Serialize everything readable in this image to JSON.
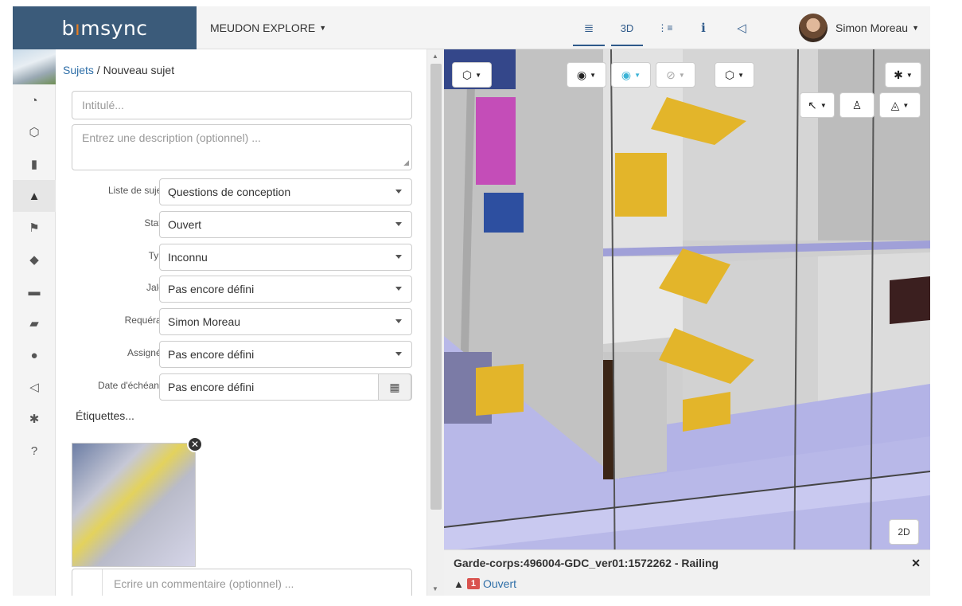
{
  "brand": {
    "pre": "b",
    "dot": "ı",
    "post": "msync"
  },
  "project": {
    "name": "MEUDON EXPLORE"
  },
  "nav": {
    "items": [
      {
        "name": "list",
        "glyph": "≣"
      },
      {
        "name": "3d",
        "glyph": "3D"
      },
      {
        "name": "tree",
        "glyph": "⋮≡"
      },
      {
        "name": "info",
        "glyph": "i"
      },
      {
        "name": "announce",
        "glyph": "◁"
      }
    ]
  },
  "user": {
    "name": "Simon Moreau"
  },
  "breadcrumb": {
    "link": "Sujets",
    "sep": " / ",
    "current": "Nouveau sujet"
  },
  "form": {
    "title_placeholder": "Intitulé...",
    "description_placeholder": "Entrez une description (optionnel) ...",
    "fields": [
      {
        "label": "Liste de sujets:",
        "value": "Questions de conception"
      },
      {
        "label": "Statut:",
        "value": "Ouvert"
      },
      {
        "label": "Type:",
        "value": "Inconnu"
      },
      {
        "label": "Jalon:",
        "value": "Pas encore défini"
      },
      {
        "label": "Requérant:",
        "value": "Simon Moreau"
      },
      {
        "label": "Assigné à:",
        "value": "Pas encore défini"
      },
      {
        "label": "Date d'échéance:",
        "value": "Pas encore défini"
      }
    ],
    "tags_label": "Étiquettes...",
    "comment_placeholder": "Ecrire un commentaire (optionnel) ..."
  },
  "viewer": {
    "mode_2d": "2D",
    "selected": "Garde-corps:496004-GDC_ver01:1572262 - Railing",
    "issue_count": "1",
    "issue_status": "Ouvert"
  },
  "colors": {
    "brand_bg": "#3b5b7a",
    "accent": "#2f6fa8",
    "stairs": "#e3b52a",
    "slab": "#b3b3e6",
    "wall": "#c7c7c7",
    "danger": "#d9534f"
  }
}
